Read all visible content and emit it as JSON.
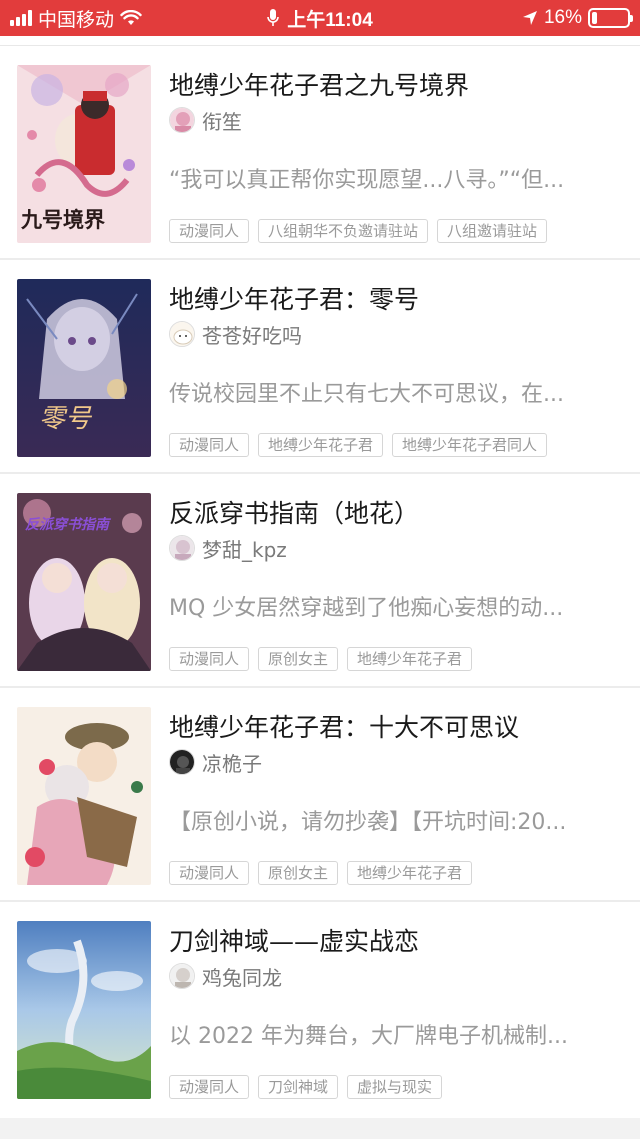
{
  "status_bar": {
    "carrier": "中国移动",
    "time": "上午11:04",
    "battery": "16%",
    "battery_level": 0.16,
    "color": "#e23c3c"
  },
  "books": [
    {
      "title": "地缚少年花子君之九号境界",
      "author": "衔笙",
      "description": "“我可以真正帮你实现愿望...八寻。”“但...",
      "tags": [
        "动漫同人",
        "八组朝华不负邀请驻站",
        "八组邀请驻站"
      ],
      "cover_text": "九号境界"
    },
    {
      "title": "地缚少年花子君：零号",
      "author": "苍苍好吃吗",
      "description": "传说校园里不止只有七大不可思议，在...",
      "tags": [
        "动漫同人",
        "地缚少年花子君",
        "地缚少年花子君同人"
      ],
      "cover_text": "零号"
    },
    {
      "title": "反派穿书指南（地花）",
      "author": "梦甜_kpz",
      "description": "MQ 少女居然穿越到了他痴心妄想的动...",
      "tags": [
        "动漫同人",
        "原创女主",
        "地缚少年花子君"
      ],
      "cover_text": "反派穿书指南"
    },
    {
      "title": "地缚少年花子君：十大不可思议",
      "author": "凉桅子",
      "description": "【原创小说，请勿抄袭】【开坑时间:20...",
      "tags": [
        "动漫同人",
        "原创女主",
        "地缚少年花子君"
      ]
    },
    {
      "title": "刀剑神域——虚实战恋",
      "author": "鸡兔同龙",
      "description": "以 2022 年为舞台，大厂牌电子机械制...",
      "tags": [
        "动漫同人",
        "刀剑神域",
        "虚拟与现实"
      ]
    }
  ]
}
